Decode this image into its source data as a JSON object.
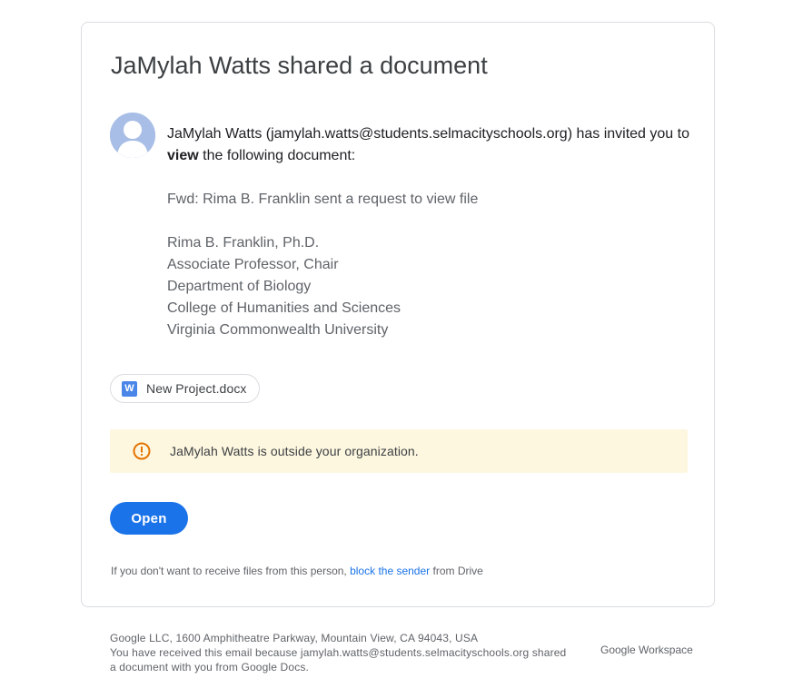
{
  "email": {
    "title": "JaMylah Watts shared a document",
    "sender_line": "JaMylah Watts (jamylah.watts@students.selmacityschools.org) has invited you",
    "invite_to": "to ",
    "invite_role": "view",
    "invite_rest": " the following document:",
    "message_lines": [
      "Fwd: Rima B. Franklin sent a request to view file",
      "Rima B. Franklin, Ph.D.",
      "Associate Professor, Chair",
      "Department of Biology",
      "College of Humanities and Sciences",
      "Virginia Commonwealth University"
    ],
    "file_icon_letter": "W",
    "file_name": "New Project.docx",
    "notice_text": "JaMylah Watts is outside your organization.",
    "open_label": "Open",
    "footnote_prefix": "If you don't want to receive files from this person, ",
    "footnote_link": "block the sender",
    "footnote_suffix": " from Drive"
  },
  "footer": {
    "address": "Google LLC, 1600 Amphitheatre Parkway, Mountain View, CA 94043, USA",
    "reason_line1": "You have received this email because jamylah.watts@students.selmacityschools.org shared",
    "reason_line2": "a document with you from Google Docs.",
    "brand": "Google Workspace"
  },
  "colors": {
    "accent": "#1a73e8",
    "notice_bg": "#fef7e0",
    "warning": "#e37400",
    "word_icon": "#4a86e8"
  },
  "icons": {
    "avatar": "default-avatar-icon",
    "file": "word-doc-icon",
    "notice": "warning-icon"
  }
}
